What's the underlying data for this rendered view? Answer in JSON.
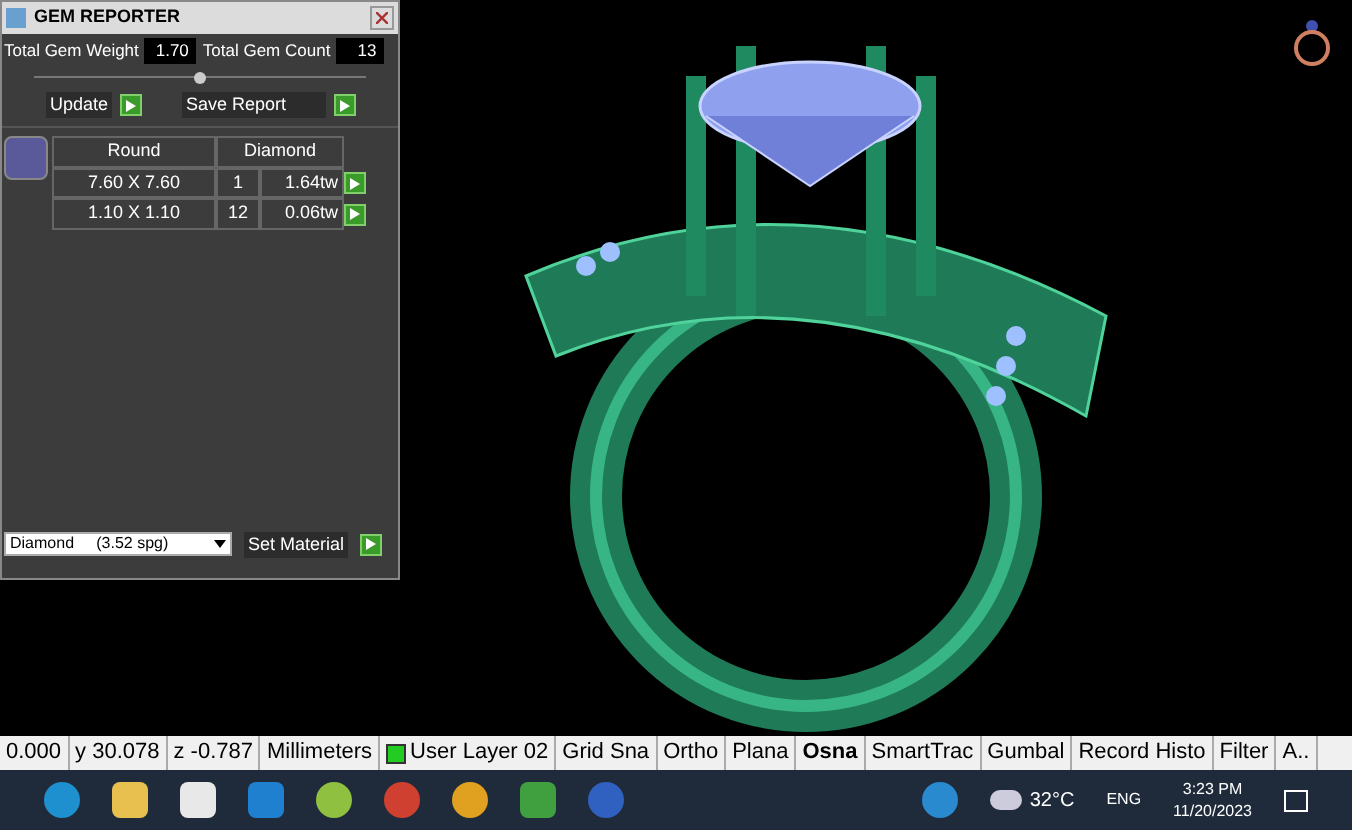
{
  "panel": {
    "title": "GEM REPORTER",
    "total_weight_label": "Total Gem Weight",
    "total_weight": "1.70",
    "total_count_label": "Total Gem Count",
    "total_count": "13",
    "divider": {
      "level": 0.5
    },
    "update_button": "Update",
    "save_button": "Save Report",
    "table": {
      "columns": [
        "Round",
        "Diamond"
      ],
      "rows": [
        {
          "size": "7.60 X 7.60",
          "count": "1",
          "weight": "1.64tw"
        },
        {
          "size": "1.10 X 1.10",
          "count": "12",
          "weight": "0.06tw"
        }
      ]
    },
    "material": "Diamond     (3.52 spg)",
    "set_material_button": "Set Material"
  },
  "status_bar": [
    {
      "text": "0.000",
      "on": false
    },
    {
      "text": "y 30.078",
      "on": false
    },
    {
      "text": "z -0.787",
      "on": false
    },
    {
      "text": "Millimeters",
      "on": false
    },
    {
      "text": "User Layer 02",
      "on": false,
      "kind": "layer",
      "color": "#22cc22"
    },
    {
      "text": "Grid Sna",
      "on": false
    },
    {
      "text": "Ortho",
      "on": false
    },
    {
      "text": "Plana",
      "on": false
    },
    {
      "text": "Osna",
      "on": true
    },
    {
      "text": "SmartTrac",
      "on": false
    },
    {
      "text": "Gumbal",
      "on": false
    },
    {
      "text": "Record Histo",
      "on": false
    },
    {
      "text": "Filter",
      "on": false
    },
    {
      "text": "A..",
      "on": false
    }
  ],
  "taskbar": {
    "temperature": "32°C",
    "language": "ENG",
    "time": "3:23 PM",
    "date": "11/20/2023"
  }
}
